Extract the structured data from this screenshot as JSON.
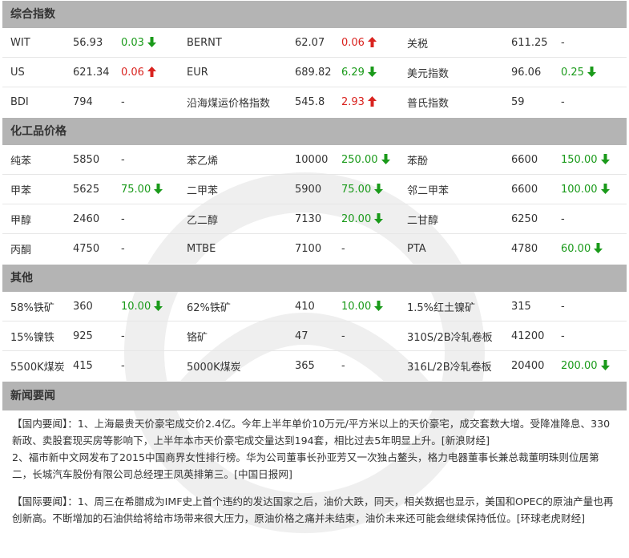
{
  "colors": {
    "up": "#d9231f",
    "down": "#1a9a1a",
    "header_bg": "#b4b4b4"
  },
  "sections": [
    {
      "title": "综合指数",
      "rows": [
        [
          {
            "name": "WIT",
            "value": "56.93",
            "change": "0.03",
            "dir": "down"
          },
          {
            "name": "BERNT",
            "value": "62.07",
            "change": "0.06",
            "dir": "up"
          },
          {
            "name": "关税",
            "value": "611.25",
            "change": "-",
            "dir": "none"
          }
        ],
        [
          {
            "name": "US",
            "value": "621.34",
            "change": "0.06",
            "dir": "up"
          },
          {
            "name": "EUR",
            "value": "689.82",
            "change": "6.29",
            "dir": "down"
          },
          {
            "name": "美元指数",
            "value": "96.06",
            "change": "0.25",
            "dir": "down"
          }
        ],
        [
          {
            "name": "BDI",
            "value": "794",
            "change": "-",
            "dir": "none"
          },
          {
            "name": "沿海煤运价格指数",
            "value": "545.8",
            "change": "2.93",
            "dir": "up"
          },
          {
            "name": "普氏指数",
            "value": "59",
            "change": "-",
            "dir": "none"
          }
        ]
      ]
    },
    {
      "title": "化工品价格",
      "rows": [
        [
          {
            "name": "纯苯",
            "value": "5850",
            "change": "-",
            "dir": "none"
          },
          {
            "name": "苯乙烯",
            "value": "10000",
            "change": "250.00",
            "dir": "down"
          },
          {
            "name": "苯酚",
            "value": "6600",
            "change": "150.00",
            "dir": "down"
          }
        ],
        [
          {
            "name": "甲苯",
            "value": "5625",
            "change": "75.00",
            "dir": "down"
          },
          {
            "name": "二甲苯",
            "value": "5900",
            "change": "75.00",
            "dir": "down"
          },
          {
            "name": "邻二甲苯",
            "value": "6600",
            "change": "100.00",
            "dir": "down"
          }
        ],
        [
          {
            "name": "甲醇",
            "value": "2460",
            "change": "-",
            "dir": "none"
          },
          {
            "name": "乙二醇",
            "value": "7130",
            "change": "20.00",
            "dir": "down"
          },
          {
            "name": "二甘醇",
            "value": "6250",
            "change": "-",
            "dir": "none"
          }
        ],
        [
          {
            "name": "丙酮",
            "value": "4750",
            "change": "-",
            "dir": "none"
          },
          {
            "name": "MTBE",
            "value": "7100",
            "change": "-",
            "dir": "none"
          },
          {
            "name": "PTA",
            "value": "4780",
            "change": "60.00",
            "dir": "down"
          }
        ]
      ]
    },
    {
      "title": "其他",
      "rows": [
        [
          {
            "name": "58%铁矿",
            "value": "360",
            "change": "10.00",
            "dir": "down"
          },
          {
            "name": "62%铁矿",
            "value": "410",
            "change": "10.00",
            "dir": "down"
          },
          {
            "name": "1.5%红土镍矿",
            "value": "315",
            "change": "-",
            "dir": "none"
          }
        ],
        [
          {
            "name": "15%镍铁",
            "value": "925",
            "change": "-",
            "dir": "none"
          },
          {
            "name": "铬矿",
            "value": "47",
            "change": "-",
            "dir": "none"
          },
          {
            "name": "310S/2B冷轧卷板",
            "value": "41200",
            "change": "-",
            "dir": "none"
          }
        ],
        [
          {
            "name": "5500K煤炭",
            "value": "415",
            "change": "-",
            "dir": "none"
          },
          {
            "name": "5000K煤炭",
            "value": "365",
            "change": "-",
            "dir": "none"
          },
          {
            "name": "316L/2B冷轧卷板",
            "value": "20400",
            "change": "200.00",
            "dir": "down"
          }
        ]
      ]
    }
  ],
  "news": {
    "title": "新闻要闻",
    "domestic": {
      "line1": "【国内要闻】：1、上海最贵天价豪宅成交价2.4亿。今年上半年单价10万元/平方米以上的天价豪宅，成交套数大增。受降准降息、330新政、卖股套现买房等影响下，上半年本市天价豪宅成交量达到194套，相比过去5年明显上升。[新浪财经]",
      "line2": "2、福市新中文网发布了2015中国商界女性排行榜。华为公司董事长孙亚芳又一次独占鳌头，格力电器董事长兼总裁董明珠则位居第二，长城汽车股份有限公司总经理王凤英排第三。[中国日报网]"
    },
    "international": {
      "line1": "【国际要闻】：1、周三在希腊成为IMF史上首个违约的发达国家之后，油价大跌，同天，相关数据也显示，美国和OPEC的原油产量也再创新高。不断增加的石油供给将给市场带来很大压力，原油价格之痛并未结束，油价未来还可能会继续保持低位。[环球老虎财经]"
    }
  }
}
